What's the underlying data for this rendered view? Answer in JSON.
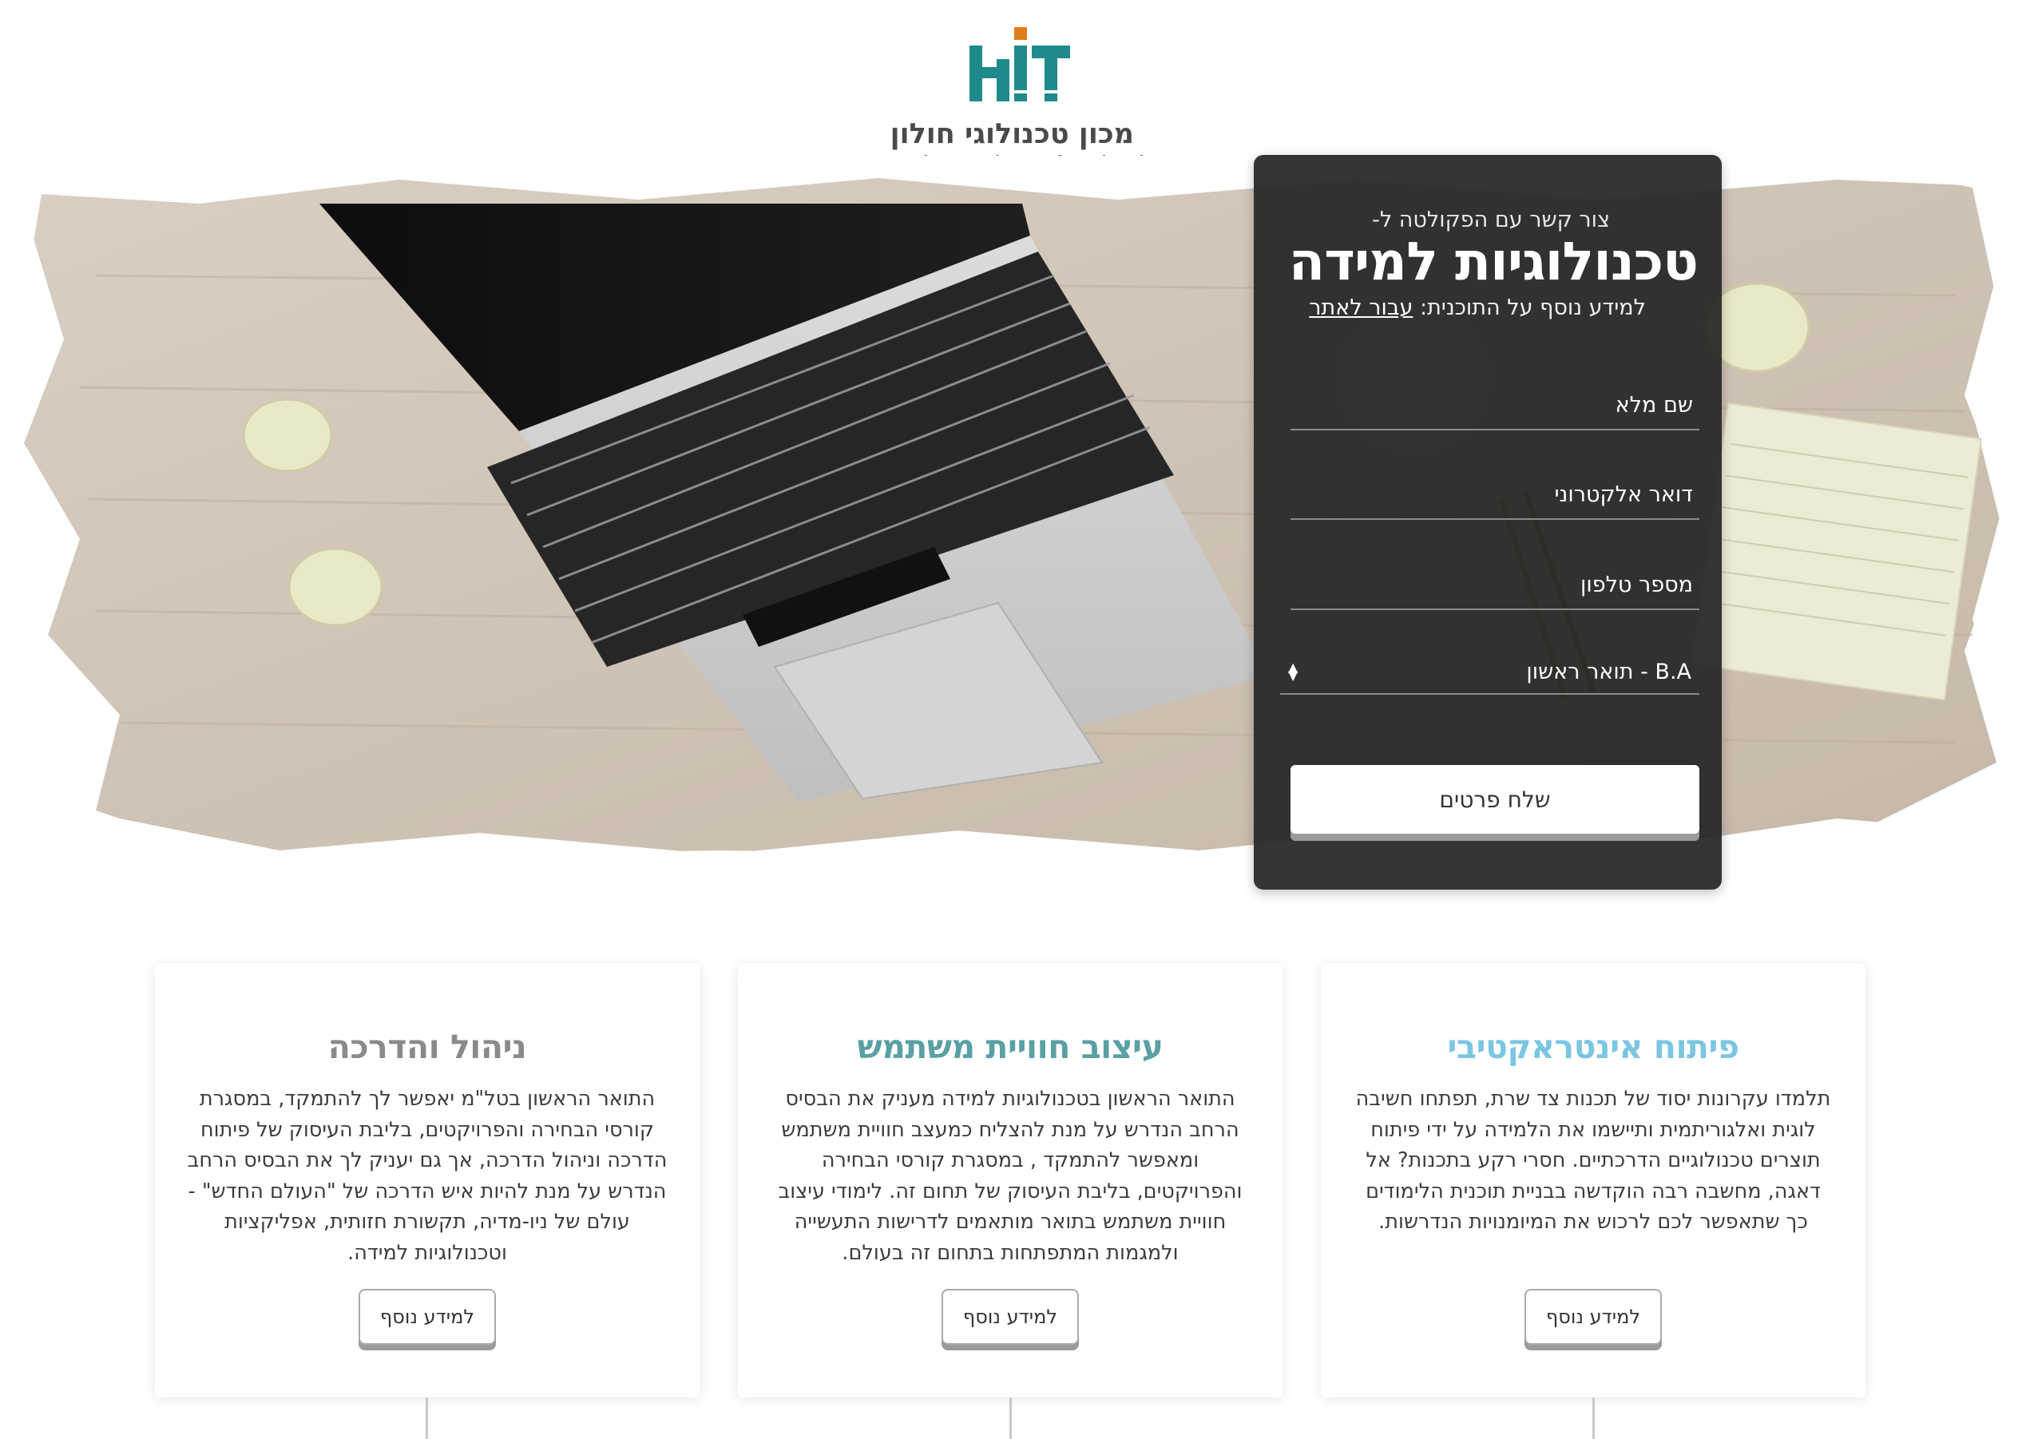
{
  "header": {
    "logo_mark": "HIT",
    "logo_hebrew": "מכון טכנולוגי חולון",
    "logo_english": "Holon Institute of Technology"
  },
  "form": {
    "kicker": "צור קשר עם הפקולטה ל-",
    "title": "טכנולוגיות למידה",
    "more_info_prefix": "למידע נוסף על התוכנית:",
    "more_info_link": "עבור לאתר",
    "name_placeholder": "שם מלא",
    "email_placeholder": "דואר אלקטרוני",
    "phone_placeholder": "מספר טלפון",
    "degree_selected": "B.A - תואר ראשון",
    "submit_label": "שלח פרטים"
  },
  "cards": [
    {
      "title": "פיתוח אינטראקטיבי",
      "title_color": "#7cc6e3",
      "text": "תלמדו עקרונות יסוד של תכנות צד שרת, תפתחו חשיבה לוגית ואלגוריתמית ותיישמו את הלמידה על ידי פיתוח תוצרים טכנולוגיים הדרכתיים. חסרי רקע בתכנות? אל דאגה, מחשבה רבה הוקדשה בבניית תוכנית הלימודים כך שתאפשר לכם לרכוש את המיומנויות הנדרשות.",
      "button_label": "למידע נוסף"
    },
    {
      "title": "עיצוב חוויית משתמש",
      "title_color": "#5aa0a4",
      "text": "התואר הראשון בטכנולוגיות למידה מעניק את הבסיס הרחב הנדרש על מנת להצליח כמעצב חוויית משתמש ומאפשר להתמקד , במסגרת קורסי הבחירה והפרויקטים, בליבת העיסוק של תחום זה. לימודי עיצוב חוויית משתמש בתואר מותאמים לדרישות התעשייה ולמגמות המתפתחות בתחום זה בעולם.",
      "button_label": "למידע נוסף"
    },
    {
      "title": "ניהול והדרכה",
      "title_color": "#8a8a8a",
      "text": "התואר הראשון בטל\"מ יאפשר לך להתמקד, במסגרת קורסי הבחירה והפרויקטים, בליבת העיסוק של פיתוח הדרכה וניהול הדרכה, אך גם יעניק לך את הבסיס הרחב הנדרש על מנת להיות איש הדרכה של \"העולם החדש\" - עולם של ניו-מדיה, תקשורת חזותית, אפליקציות וטכנולוגיות למידה.",
      "button_label": "למידע נוסף"
    }
  ],
  "colors": {
    "brand_teal": "#1f8a8c",
    "brand_orange": "#e07b1a",
    "panel_bg": "#262626"
  }
}
